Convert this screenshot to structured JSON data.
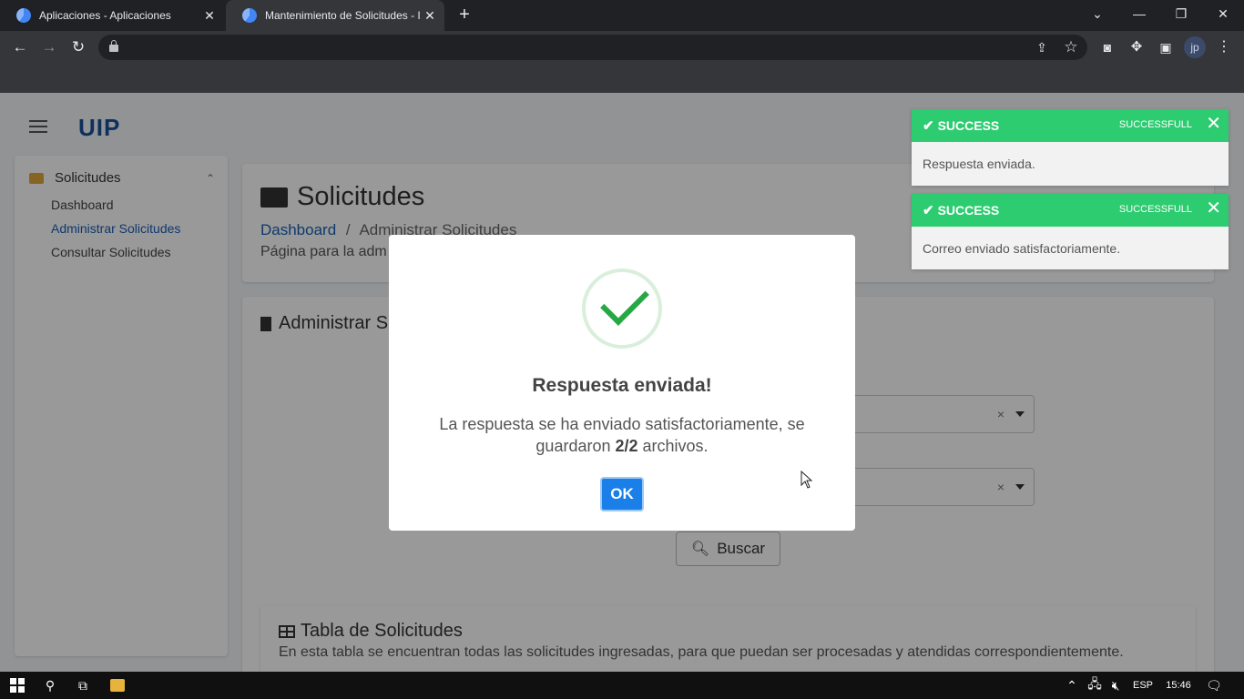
{
  "browser": {
    "tabs": [
      {
        "title": "Aplicaciones - Aplicaciones"
      },
      {
        "title": "Mantenimiento de Solicitudes - I"
      }
    ],
    "new_tab_glyph": "+",
    "close_glyph": "✕",
    "window_controls": {
      "chevron": "⌄",
      "minimize": "—",
      "restore": "❐",
      "close": "✕"
    },
    "nav": {
      "back": "←",
      "forward": "→",
      "reload": "↻"
    },
    "avatar_initials": "jp"
  },
  "app": {
    "brand": "UIP",
    "sidebar": {
      "section": "Solicitudes",
      "items": [
        {
          "label": "Dashboard"
        },
        {
          "label": "Administrar Solicitudes"
        },
        {
          "label": "Consultar Solicitudes"
        }
      ]
    },
    "header": {
      "title": "Solicitudes",
      "breadcrumb_link": "Dashboard",
      "breadcrumb_sep": "/",
      "breadcrumb_current": "Administrar Solicitudes",
      "subtitle": "Página para la adm"
    },
    "admin_title": "Administrar S",
    "select_clear": "×",
    "search_button": "Buscar",
    "table": {
      "title": "Tabla de Solicitudes",
      "description": "En esta tabla se encuentran todas las solicitudes ingresadas, para que puedan ser procesadas y atendidas correspondientemente."
    }
  },
  "toasts": [
    {
      "title": "SUCCESS",
      "status": "SUCCESSFULL",
      "message": "Respuesta enviada.",
      "close": "✕"
    },
    {
      "title": "SUCCESS",
      "status": "SUCCESSFULL",
      "message": "Correo enviado satisfactoriamente.",
      "close": "✕"
    }
  ],
  "modal": {
    "title": "Respuesta enviada!",
    "text_before": "La respuesta se ha enviado satisfactoriamente, se guardaron ",
    "text_bold": "2/2",
    "text_after": " archivos.",
    "ok_button": "OK"
  },
  "taskbar": {
    "language": "ESP",
    "time": "15:46"
  },
  "colors": {
    "success": "#2ecc71",
    "primary": "#1a7fe8",
    "brand": "#1a4f99"
  }
}
